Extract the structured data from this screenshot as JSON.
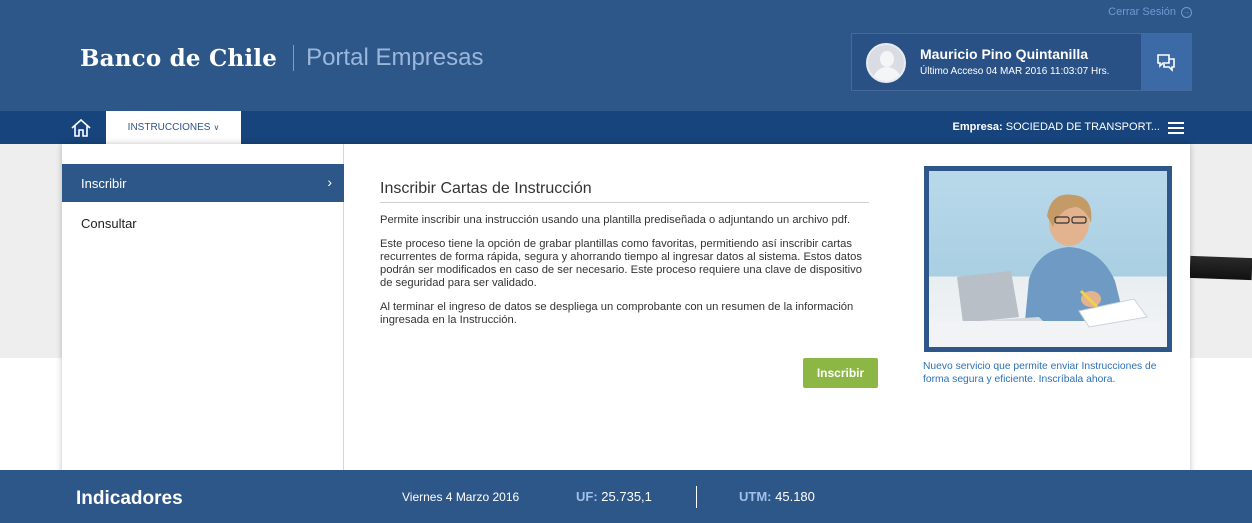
{
  "header": {
    "logout_label": "Cerrar Sesión",
    "brand_name": "Banco de Chile",
    "portal_name": "Portal Empresas",
    "user": {
      "name": "Mauricio Pino Quintanilla",
      "last_access": "Último Acceso 04 MAR 2016 11:03:07 Hrs."
    }
  },
  "nav": {
    "tab_label": "INSTRUCCIONES",
    "empresa_label": "Empresa:",
    "empresa_value": "SOCIEDAD DE TRANSPORT..."
  },
  "sidebar": {
    "items": [
      {
        "label": "Inscribir"
      },
      {
        "label": "Consultar"
      }
    ]
  },
  "main": {
    "title": "Inscribir Cartas de Instrucción",
    "paragraphs": [
      "Permite inscribir una instrucción usando una plantilla prediseñada o adjuntando un archivo pdf.",
      "Este proceso tiene la opción de grabar plantillas como favoritas, permitiendo así inscribir cartas recurrentes de forma rápida, segura y ahorrando tiempo al ingresar datos al sistema. Estos datos podrán ser modificados en caso de ser necesario. Este proceso requiere una clave de dispositivo de seguridad para ser validado.",
      "Al terminar el ingreso de datos se despliega un comprobante con un resumen de la información ingresada en la Instrucción."
    ],
    "button_label": "Inscribir"
  },
  "promo": {
    "caption": "Nuevo servicio que permite enviar Instrucciones de forma segura y eficiente. Inscríbala ahora."
  },
  "footer": {
    "title": "Indicadores",
    "date": "Viernes 4 Marzo 2016",
    "uf_label": "UF:",
    "uf_value": "25.735,1",
    "utm_label": "UTM:",
    "utm_value": "45.180"
  },
  "colors": {
    "header_bg": "#2d5689",
    "nav_bg": "#17447d",
    "accent_green": "#8db744",
    "link_blue": "#2c71b8"
  }
}
